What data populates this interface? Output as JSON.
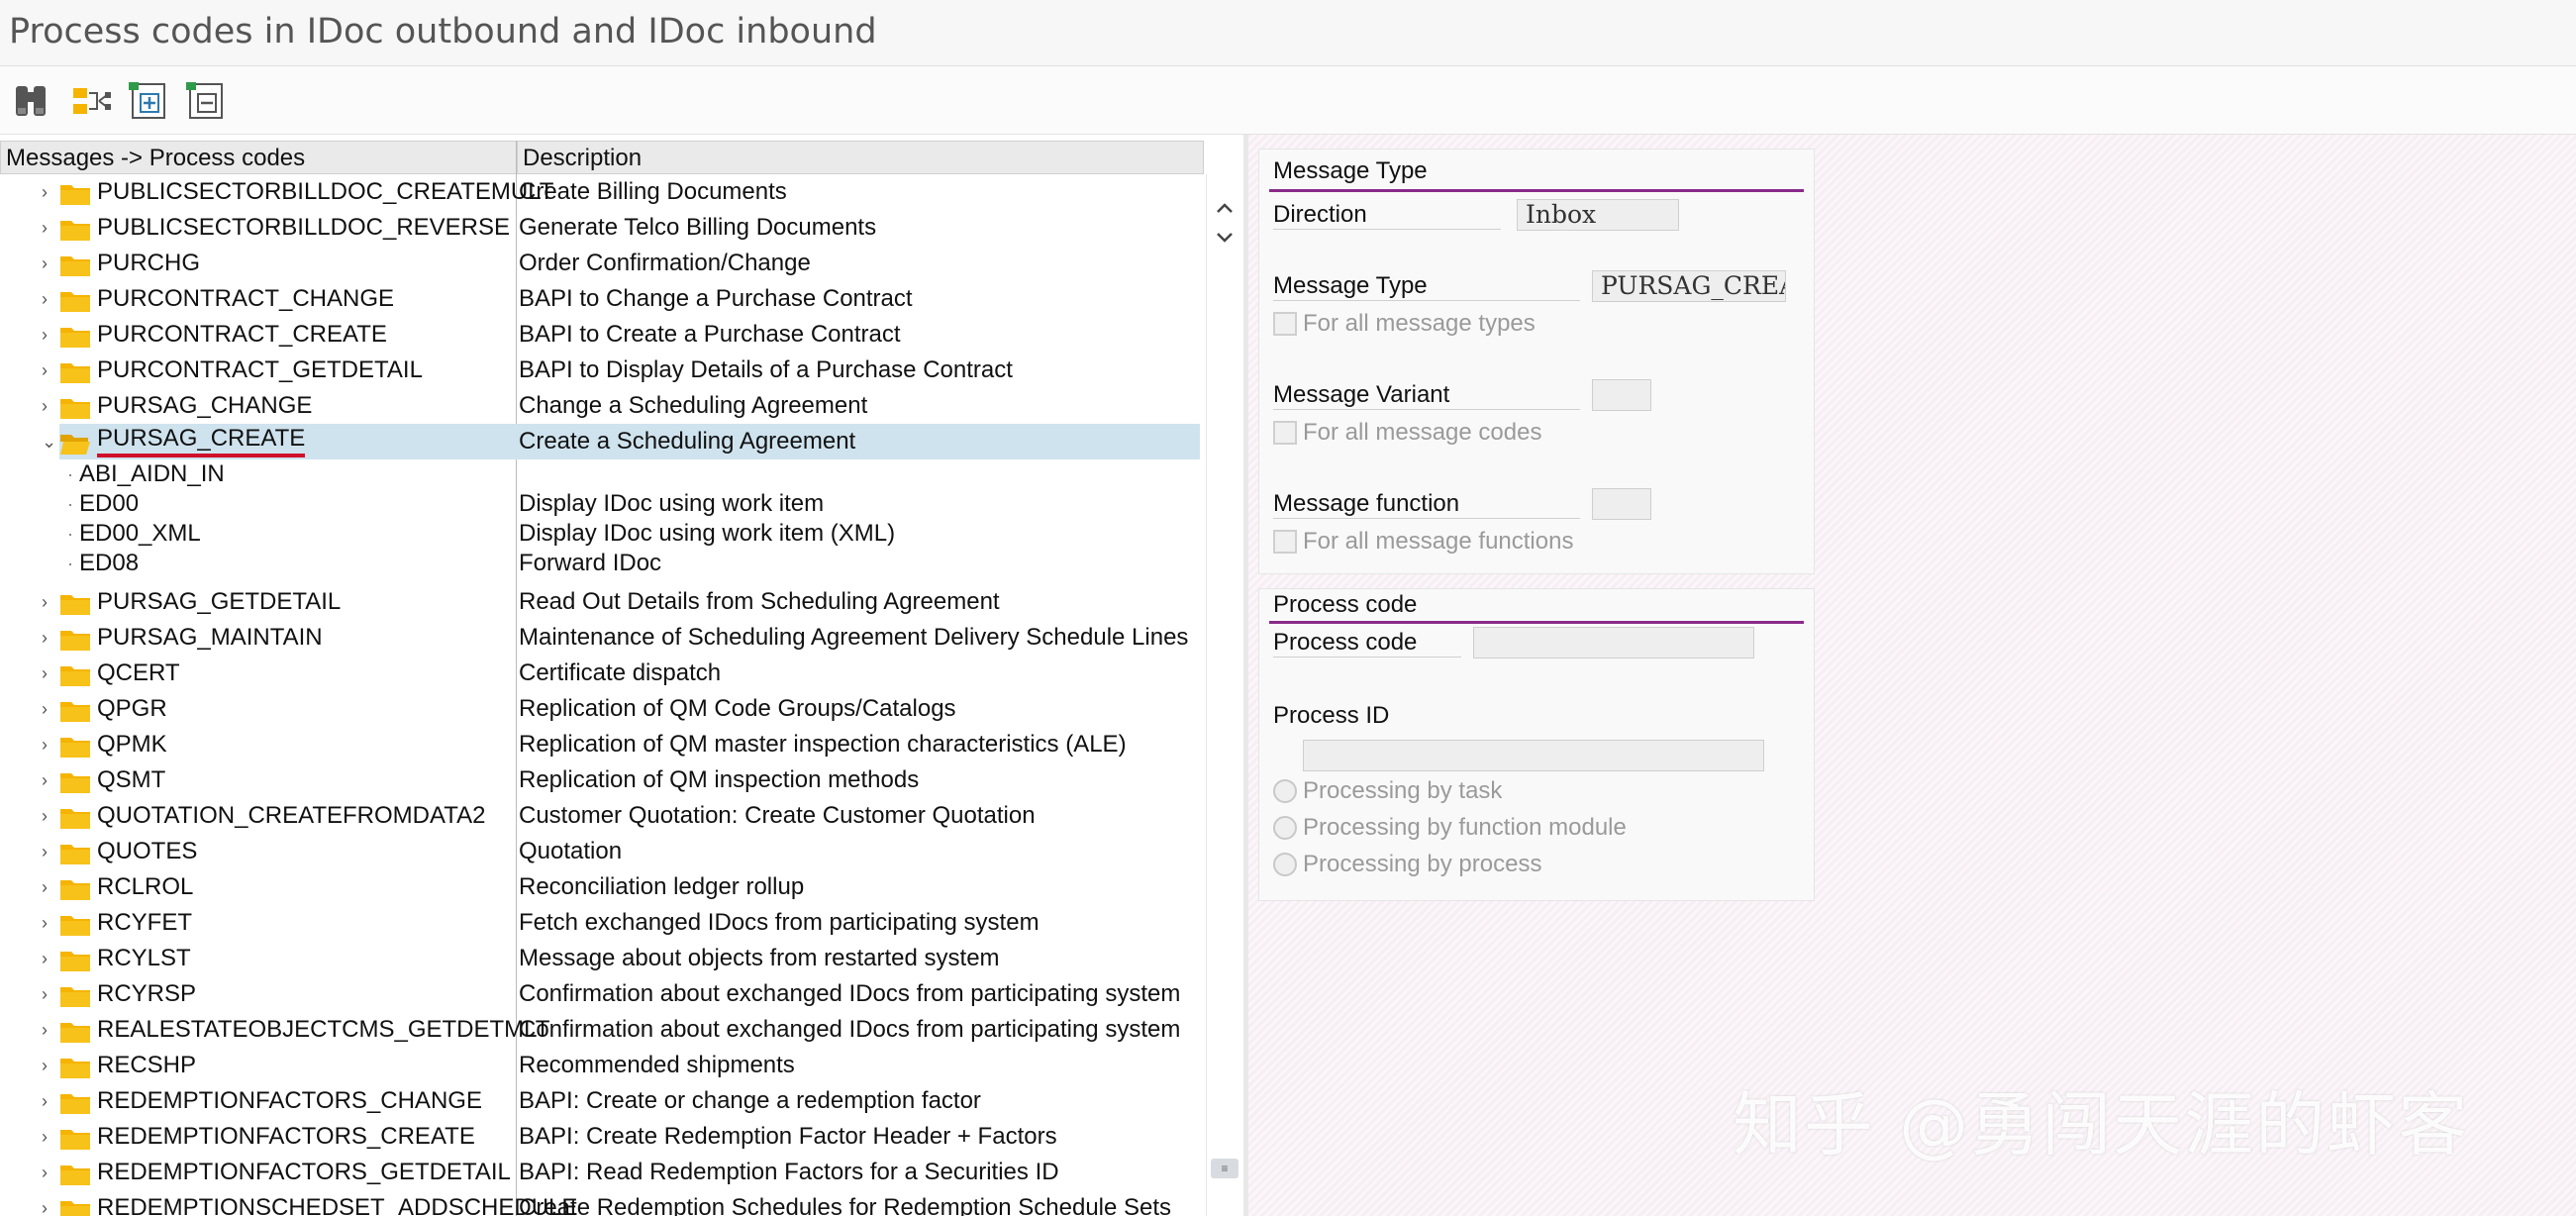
{
  "window": {
    "title": "Process codes in IDoc outbound and IDoc inbound"
  },
  "toolbar": {
    "buttons": [
      "binoculars-icon",
      "expand-tree-icon",
      "expand-subtree-icon",
      "collapse-subtree-icon"
    ]
  },
  "tree": {
    "columns": {
      "messages": "Messages -> Process codes",
      "description": "Description"
    },
    "rows": [
      {
        "name": "PUBLICSECTORBILLDOC_CREATEMULT",
        "desc": "Create Billing Documents"
      },
      {
        "name": "PUBLICSECTORBILLDOC_REVERSE",
        "desc": "Generate Telco Billing Documents"
      },
      {
        "name": "PURCHG",
        "desc": "Order Confirmation/Change"
      },
      {
        "name": "PURCONTRACT_CHANGE",
        "desc": "BAPI to Change a Purchase Contract"
      },
      {
        "name": "PURCONTRACT_CREATE",
        "desc": "BAPI to Create a Purchase Contract"
      },
      {
        "name": "PURCONTRACT_GETDETAIL",
        "desc": "BAPI to Display Details of a Purchase Contract"
      },
      {
        "name": "PURSAG_CHANGE",
        "desc": "Change a Scheduling Agreement"
      },
      {
        "name": "PURSAG_CREATE",
        "desc": "Create a Scheduling Agreement"
      }
    ],
    "children": [
      {
        "name": "ABI_AIDN_IN",
        "desc": ""
      },
      {
        "name": "ED00",
        "desc": "Display IDoc using work item"
      },
      {
        "name": "ED00_XML",
        "desc": "Display IDoc using work item (XML)"
      },
      {
        "name": "ED08",
        "desc": "Forward IDoc"
      }
    ],
    "rows_after": [
      {
        "name": "PURSAG_GETDETAIL",
        "desc": "Read Out Details from Scheduling Agreement"
      },
      {
        "name": "PURSAG_MAINTAIN",
        "desc": "Maintenance of Scheduling Agreement Delivery Schedule Lines"
      },
      {
        "name": "QCERT",
        "desc": "Certificate dispatch"
      },
      {
        "name": "QPGR",
        "desc": "Replication of QM Code Groups/Catalogs"
      },
      {
        "name": "QPMK",
        "desc": "Replication of QM master inspection characteristics (ALE)"
      },
      {
        "name": "QSMT",
        "desc": "Replication of QM inspection methods"
      },
      {
        "name": "QUOTATION_CREATEFROMDATA2",
        "desc": "Customer Quotation: Create Customer Quotation"
      },
      {
        "name": "QUOTES",
        "desc": "Quotation"
      },
      {
        "name": "RCLROL",
        "desc": "Reconciliation ledger rollup"
      },
      {
        "name": "RCYFET",
        "desc": "Fetch exchanged IDocs from participating system"
      },
      {
        "name": "RCYLST",
        "desc": "Message about objects from restarted system"
      },
      {
        "name": "RCYRSP",
        "desc": "Confirmation about exchanged IDocs from participating system"
      },
      {
        "name": "REALESTATEOBJECTCMS_GETDETMLT",
        "desc": "Confirmation about exchanged IDocs from participating system"
      },
      {
        "name": "RECSHP",
        "desc": "Recommended shipments"
      },
      {
        "name": "REDEMPTIONFACTORS_CHANGE",
        "desc": "BAPI: Create or change a redemption factor"
      },
      {
        "name": "REDEMPTIONFACTORS_CREATE",
        "desc": "BAPI: Create Redemption Factor Header + Factors"
      },
      {
        "name": "REDEMPTIONFACTORS_GETDETAIL",
        "desc": "BAPI: Read Redemption Factors for a Securities ID"
      },
      {
        "name": "REDEMPTIONSCHEDSET_ADDSCHEDULE",
        "desc": "Create Redemption Schedules for Redemption Schedule Sets"
      }
    ]
  },
  "message_type_panel": {
    "title": "Message Type",
    "direction_label": "Direction",
    "direction_value": "Inbox",
    "message_type_label": "Message Type",
    "message_type_value": "PURSAG_CREA",
    "all_types_label": "For all message types",
    "variant_label": "Message Variant",
    "variant_value": "",
    "all_codes_label": "For all message codes",
    "function_label": "Message function",
    "function_value": "",
    "all_functions_label": "For all message functions"
  },
  "process_code_panel": {
    "title": "Process code",
    "process_code_label": "Process code",
    "process_code_value": "",
    "process_id_label": "Process ID",
    "process_id_value": "",
    "options": [
      "Processing by task",
      "Processing by function module",
      "Processing by process"
    ]
  },
  "watermark": "知乎 @勇闯天涯的虾客",
  "colors": {
    "selection": "#cfe3ee",
    "accent": "#8a2a8a",
    "folder": "#f5b400",
    "underline": "#d0102a"
  }
}
